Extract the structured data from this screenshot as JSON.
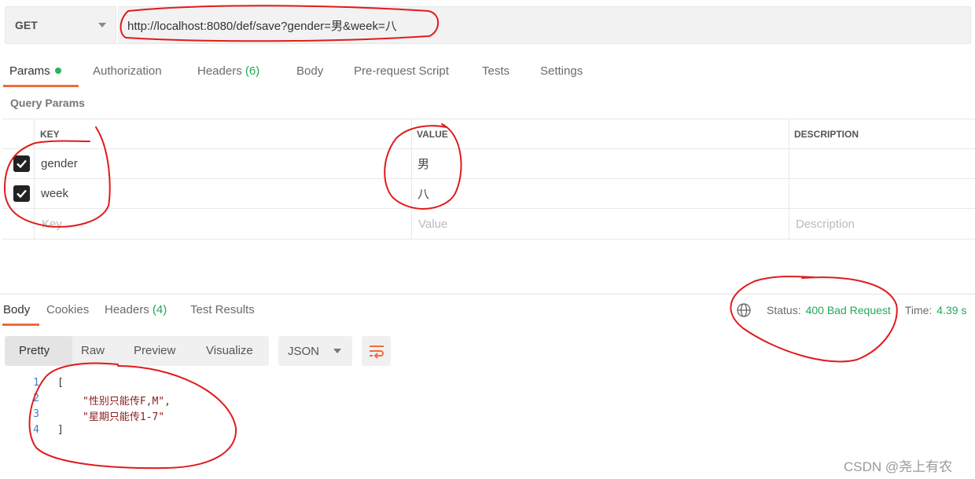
{
  "request": {
    "method": "GET",
    "url": "http://localhost:8080/def/save?gender=男&week=八"
  },
  "request_tabs": [
    {
      "label": "Params",
      "count": ""
    },
    {
      "label": "Authorization",
      "count": ""
    },
    {
      "label": "Headers",
      "count": "(6)"
    },
    {
      "label": "Body",
      "count": ""
    },
    {
      "label": "Pre-request Script",
      "count": ""
    },
    {
      "label": "Tests",
      "count": ""
    },
    {
      "label": "Settings",
      "count": ""
    }
  ],
  "query_params": {
    "title": "Query Params",
    "columns": [
      "KEY",
      "VALUE",
      "DESCRIPTION"
    ],
    "rows": [
      {
        "key": "gender",
        "value": "男",
        "checked": true
      },
      {
        "key": "week",
        "value": "八",
        "checked": true
      }
    ],
    "placeholders": {
      "key": "Key",
      "value": "Value",
      "description": "Description"
    }
  },
  "response_tabs": [
    {
      "label": "Body",
      "count": ""
    },
    {
      "label": "Cookies",
      "count": ""
    },
    {
      "label": "Headers",
      "count": "(4)"
    },
    {
      "label": "Test Results",
      "count": ""
    }
  ],
  "status": {
    "status_label": "Status:",
    "status_value": "400 Bad Request",
    "time_label": "Time:",
    "time_value": "4.39 s"
  },
  "view_modes": [
    "Pretty",
    "Raw",
    "Preview",
    "Visualize"
  ],
  "format": "JSON",
  "response_body": {
    "line_numbers": [
      "1",
      "2",
      "3",
      "4"
    ],
    "lines": [
      "[",
      "\"性别只能传F,M\",",
      "\"星期只能传1-7\"",
      "]"
    ]
  },
  "watermark": "CSDN @尧上有农",
  "colors": {
    "accent": "#f26b3a",
    "success": "#26a55a",
    "annotation": "#e01b1b"
  }
}
